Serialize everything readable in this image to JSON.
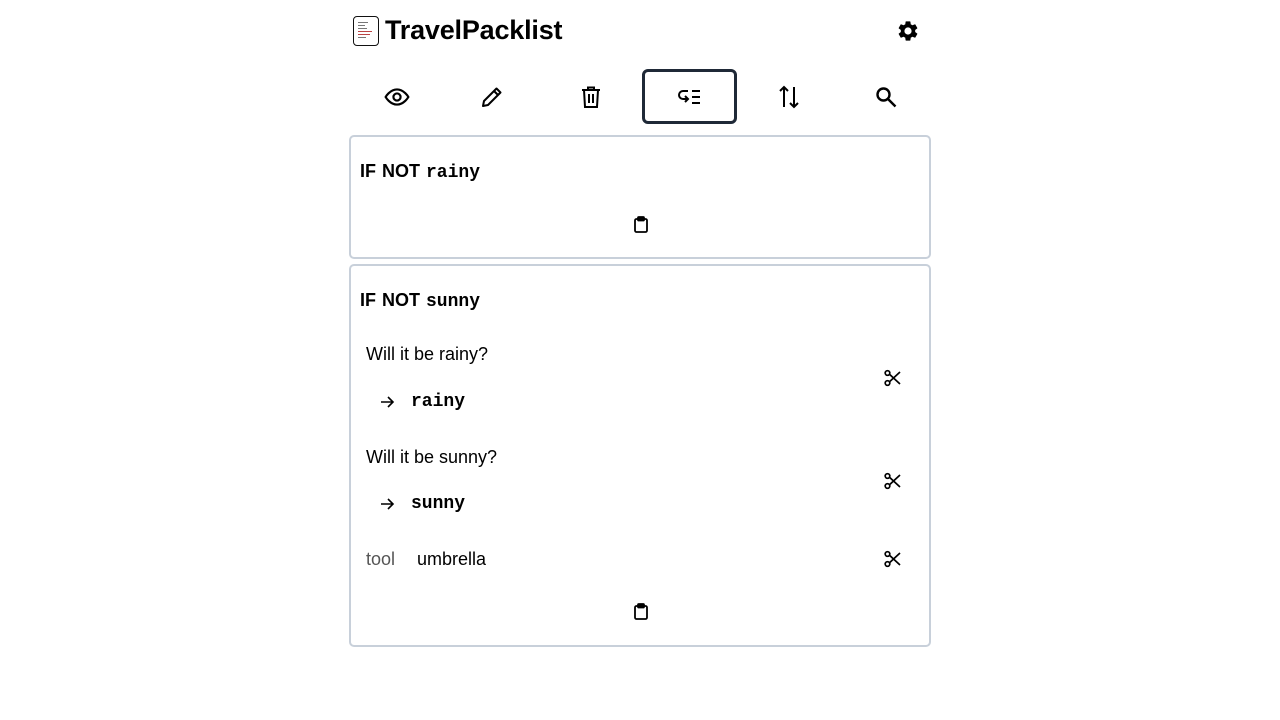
{
  "app": {
    "title": "TravelPacklist",
    "logo_icon": "packlist-logo-icon",
    "settings_icon": "gear-icon"
  },
  "toolbar": {
    "buttons": [
      {
        "name": "view",
        "icon": "eye-icon",
        "active": false
      },
      {
        "name": "edit",
        "icon": "pencil-icon",
        "active": false
      },
      {
        "name": "delete",
        "icon": "trash-icon",
        "active": false
      },
      {
        "name": "conditions",
        "icon": "conditional-list-icon",
        "active": true
      },
      {
        "name": "sort",
        "icon": "swap-vertical-icon",
        "active": false
      },
      {
        "name": "search",
        "icon": "search-icon",
        "active": false
      }
    ]
  },
  "cards": [
    {
      "keyword_if": "IF",
      "keyword_not": "NOT",
      "variable": "rainy",
      "entries": []
    },
    {
      "keyword_if": "IF",
      "keyword_not": "NOT",
      "variable": "sunny",
      "entries": [
        {
          "type": "question",
          "text": "Will it be rainy?",
          "target": "rainy"
        },
        {
          "type": "question",
          "text": "Will it be sunny?",
          "target": "sunny"
        },
        {
          "type": "item",
          "category": "tool",
          "name": "umbrella"
        }
      ]
    }
  ],
  "colors": {
    "card_border": "#c8d0da",
    "active_border": "#1f2937",
    "category_text": "#555555"
  }
}
